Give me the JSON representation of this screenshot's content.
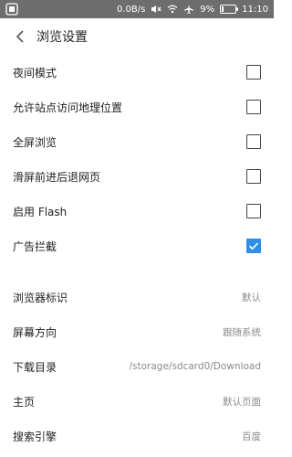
{
  "statusbar": {
    "speed": "0.0B/s",
    "battery": "9%",
    "time": "11:10"
  },
  "header": {
    "title": "浏览设置"
  },
  "toggles": [
    {
      "label": "夜间模式",
      "checked": false
    },
    {
      "label": "允许站点访问地理位置",
      "checked": false
    },
    {
      "label": "全屏浏览",
      "checked": false
    },
    {
      "label": "滑屏前进后退网页",
      "checked": false
    },
    {
      "label": "启用 Flash",
      "checked": false
    },
    {
      "label": "广告拦截",
      "checked": true
    }
  ],
  "settings": [
    {
      "label": "浏览器标识",
      "value": "默认"
    },
    {
      "label": "屏幕方向",
      "value": "跟随系统"
    },
    {
      "label": "下载目录",
      "value": "/storage/sdcard0/Download"
    },
    {
      "label": "主页",
      "value": "默认页面"
    },
    {
      "label": "搜索引擎",
      "value": "百度"
    }
  ],
  "colors": {
    "statusbar_bg": "#6d6d6d",
    "accent": "#2f8fe6"
  }
}
